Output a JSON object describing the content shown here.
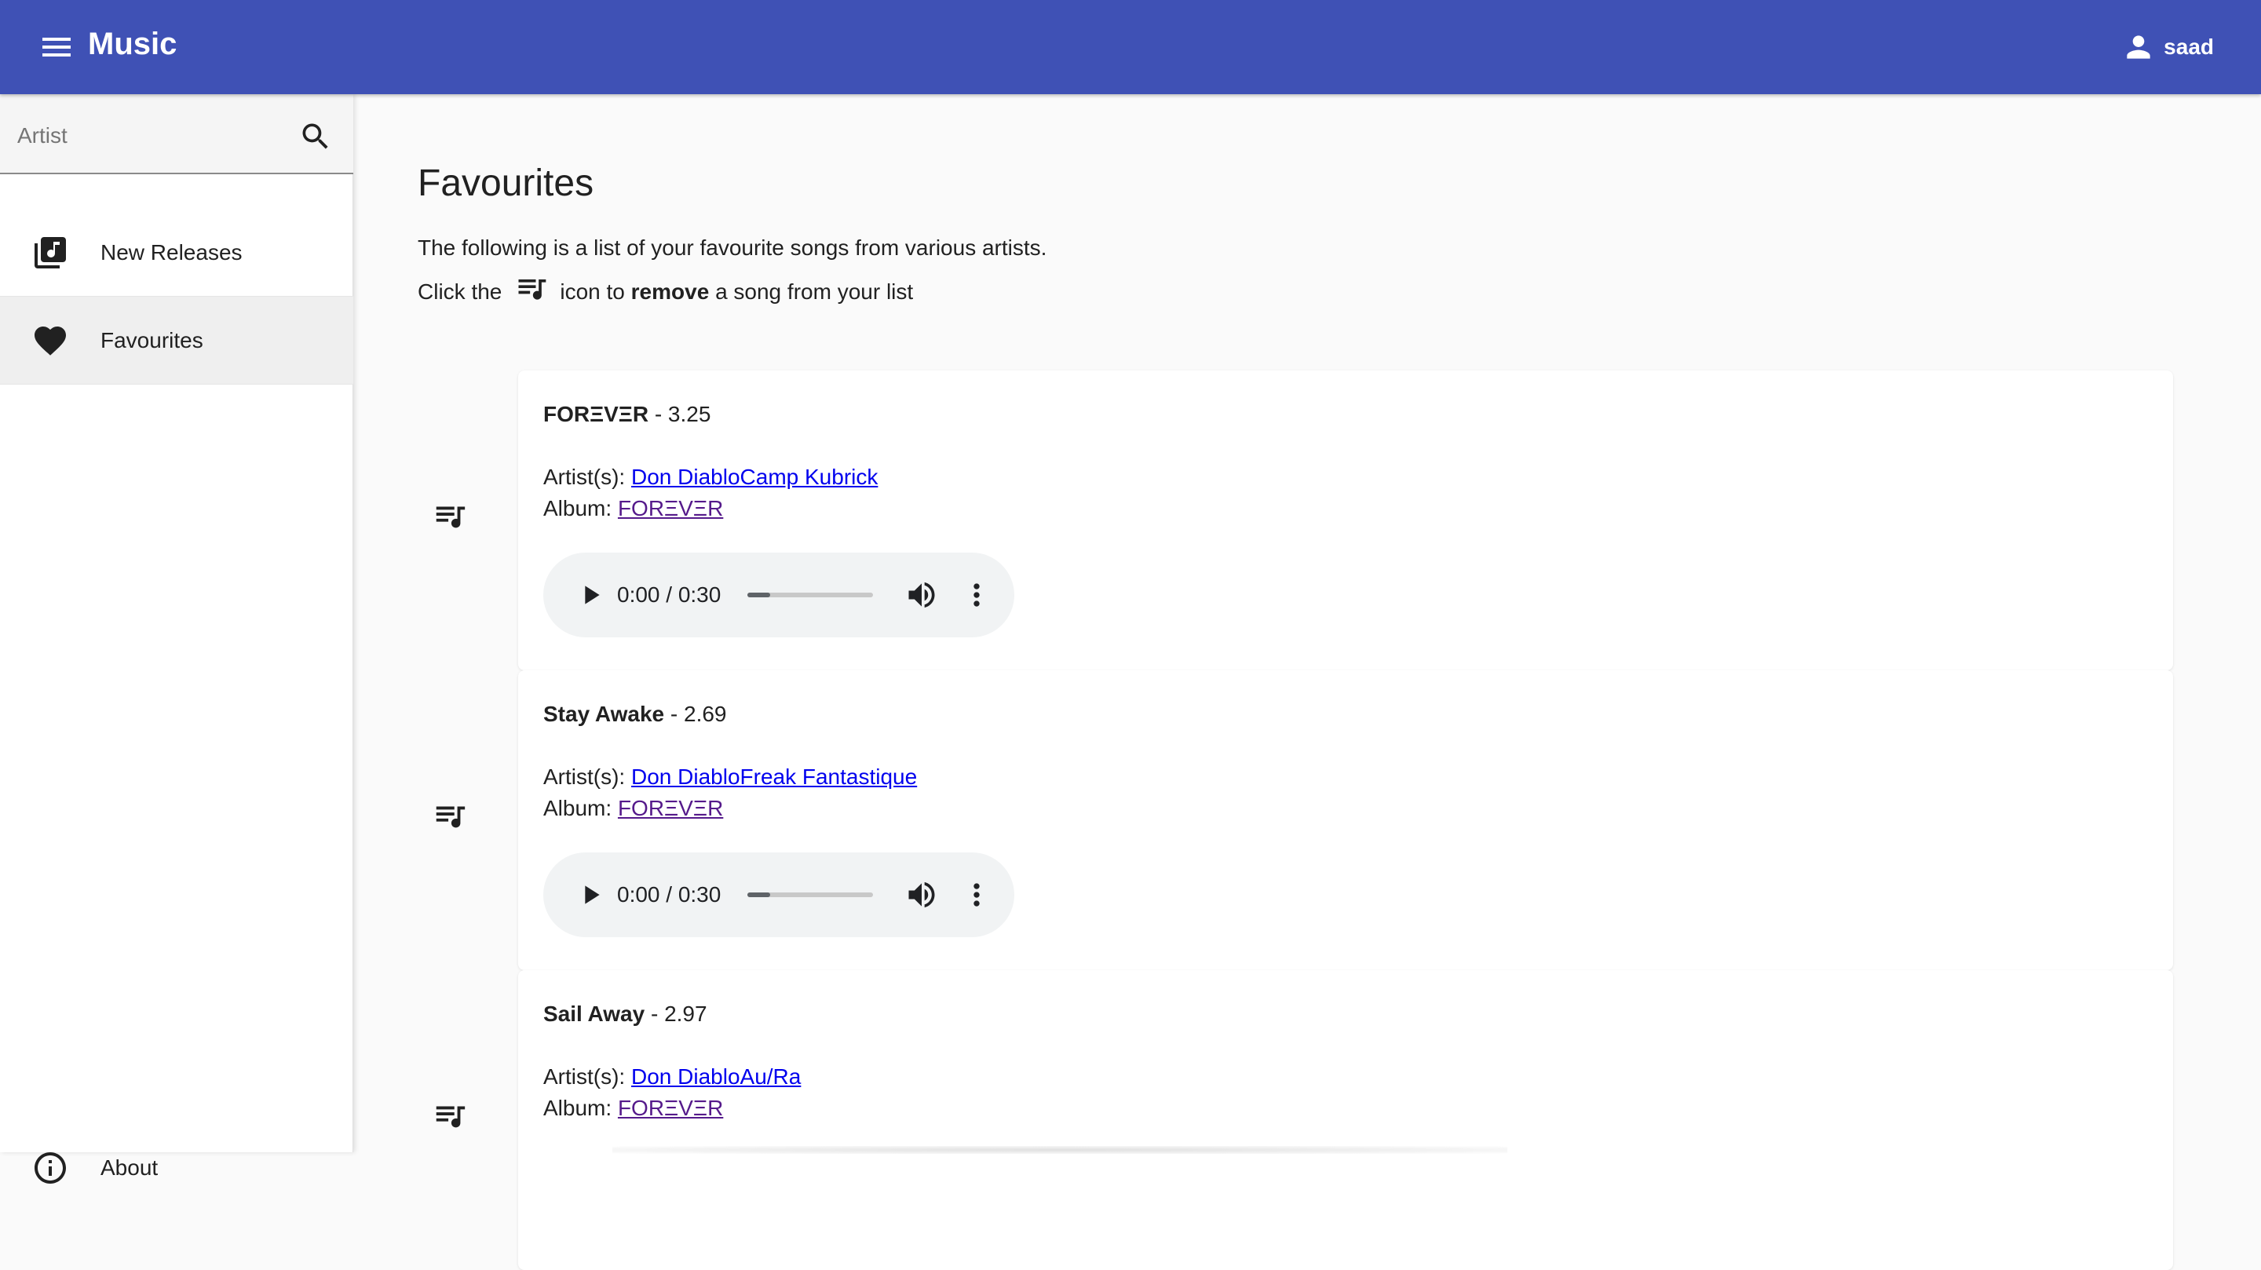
{
  "app": {
    "title": "Music",
    "user": "saad"
  },
  "sidebar": {
    "search_placeholder": "Artist",
    "items": [
      {
        "label": "New Releases",
        "icon": "library-music-icon"
      },
      {
        "label": "Favourites",
        "icon": "heart-icon",
        "active": true
      }
    ],
    "about_label": "About"
  },
  "main": {
    "title": "Favourites",
    "intro_line1": "The following is a list of your favourite songs from various artists.",
    "intro_click": "Click the",
    "intro_icon_to": "icon to",
    "intro_remove": "remove",
    "intro_tail": "a song from your list"
  },
  "songs": [
    {
      "name": "FORΞVΞR",
      "score": " - 3.25",
      "artists_label": "Artist(s): ",
      "artists": "Don DiabloCamp Kubrick",
      "album_label": "Album: ",
      "album": "FORΞVΞR",
      "time": "0:00 / 0:30",
      "progress": 0.18
    },
    {
      "name": "Stay Awake",
      "score": " - 2.69",
      "artists_label": "Artist(s): ",
      "artists": "Don DiabloFreak Fantastique",
      "album_label": "Album: ",
      "album": "FORΞVΞR",
      "time": "0:00 / 0:30",
      "progress": 0.18
    },
    {
      "name": "Sail Away",
      "score": " - 2.97",
      "artists_label": "Artist(s): ",
      "artists": "Don DiabloAu/Ra",
      "album_label": "Album: ",
      "album": "FORΞVΞR"
    }
  ],
  "colors": {
    "toolbar": "#3f51b5",
    "link": "#0000ee",
    "visited_link": "#551a8b"
  }
}
